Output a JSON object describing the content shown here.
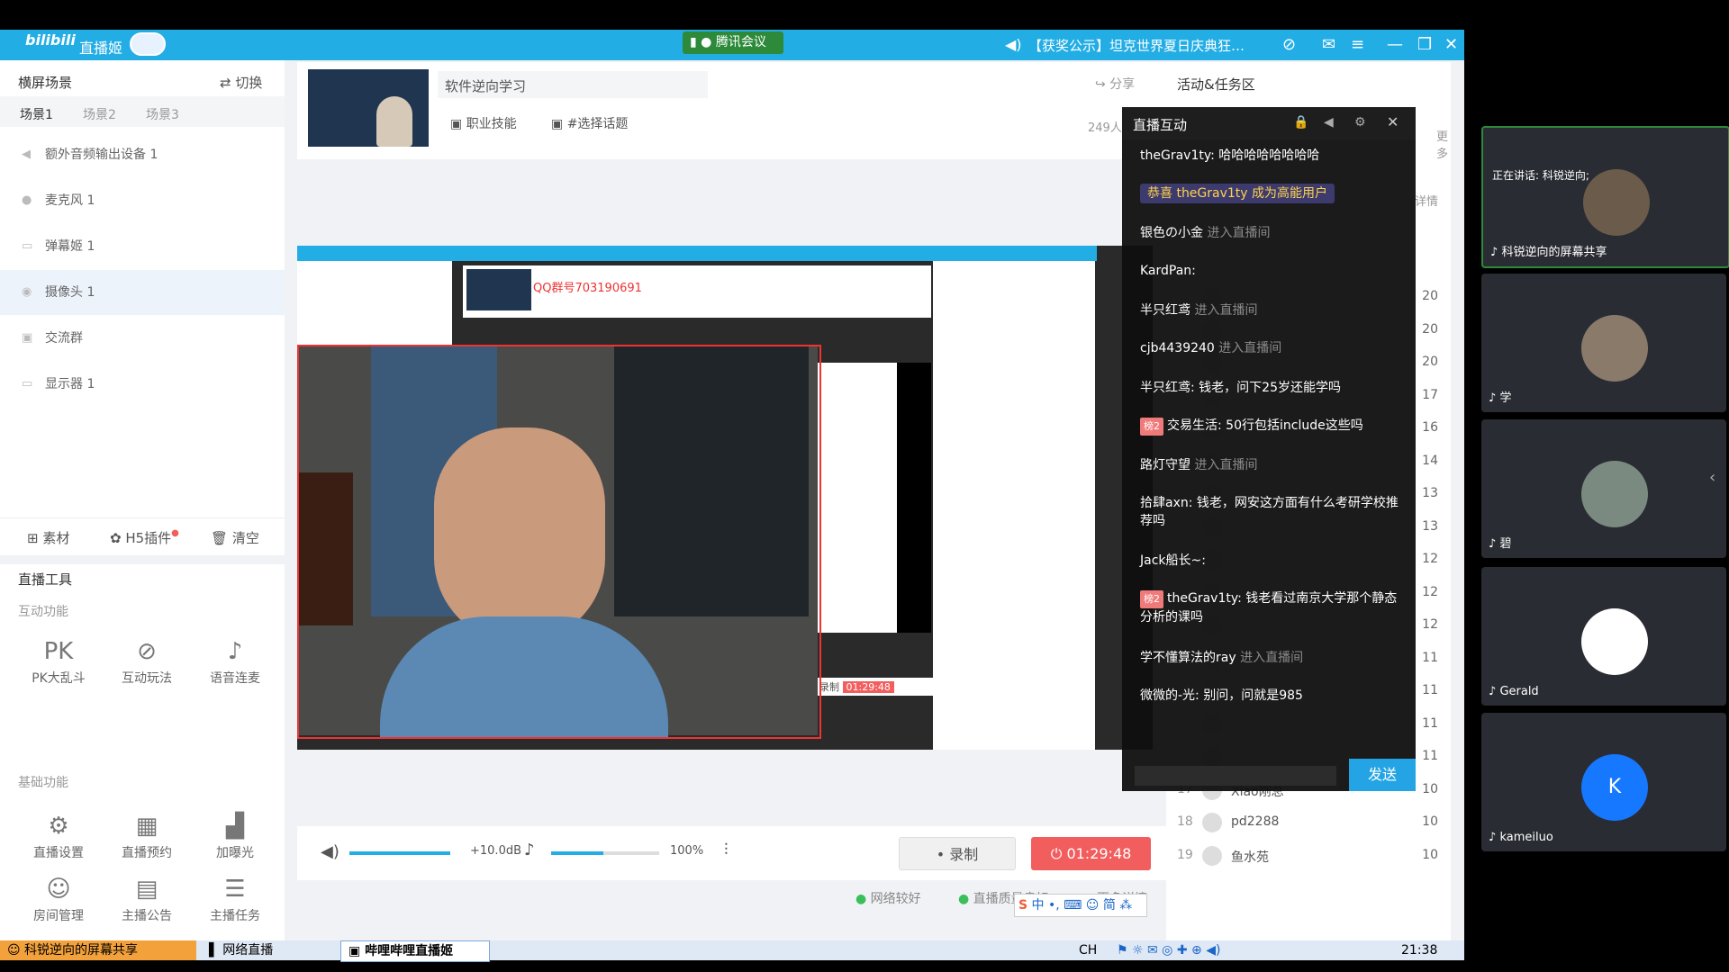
{
  "app": {
    "title": "直播姬",
    "logo": "bilibili"
  },
  "meeting": {
    "label": "腾讯会议",
    "screen_share_label": "科锐逆向的屏幕共享",
    "speaking": "正在讲话: 科锐逆向;"
  },
  "titlebar": {
    "announcement": "【获奖公示】坦克世界夏日庆典狂…"
  },
  "left": {
    "scene_title": "横屏场景",
    "switch_label": "切换",
    "scenes": [
      "场景1",
      "场景2",
      "场景3"
    ],
    "sources": [
      {
        "name": "额外音频输出设备",
        "count": "1",
        "icon": "speaker"
      },
      {
        "name": "麦克风",
        "count": "1",
        "icon": "mic"
      },
      {
        "name": "弹幕姬",
        "count": "1",
        "icon": "chat"
      },
      {
        "name": "摄像头",
        "count": "1",
        "icon": "camera"
      },
      {
        "name": "交流群",
        "count": "",
        "icon": "group"
      },
      {
        "name": "显示器",
        "count": "1",
        "icon": "monitor"
      }
    ],
    "actions": {
      "material": "素材",
      "h5": "H5插件",
      "clear": "清空"
    },
    "tools_title": "直播工具",
    "interactive_title": "互动功能",
    "interactive": [
      "PK大乱斗",
      "互动玩法",
      "语音连麦"
    ],
    "basic_title": "基础功能",
    "basic": [
      "直播设置",
      "直播预约",
      "加曝光",
      "房间管理",
      "主播公告",
      "主播任务"
    ]
  },
  "header": {
    "stream_title": "软件逆向学习",
    "share": "分享",
    "category": "职业技能",
    "topic": "#选择话题",
    "viewers": "249人"
  },
  "controls": {
    "volume_db": "+10.0dB",
    "volume_pct": 1.0,
    "mic_pct": "100%",
    "mic_level": 0.48,
    "record": "录制",
    "timer": "01:29:48"
  },
  "status": {
    "network": "网络较好",
    "quality": "直播质量良好",
    "more": "更多详情"
  },
  "activity": {
    "title": "活动&任务区",
    "more": "更多",
    "detail": "详情"
  },
  "ranks": [
    {
      "rank": "",
      "name": "",
      "score": "20"
    },
    {
      "rank": "",
      "name": "",
      "score": "20"
    },
    {
      "rank": "",
      "name": "",
      "score": "20"
    },
    {
      "rank": "",
      "name": "",
      "score": "17"
    },
    {
      "rank": "",
      "name": "",
      "score": "16"
    },
    {
      "rank": "",
      "name": "",
      "score": "14"
    },
    {
      "rank": "",
      "name": "",
      "score": "13"
    },
    {
      "rank": "",
      "name": "",
      "score": "13"
    },
    {
      "rank": "",
      "name": "",
      "score": "12"
    },
    {
      "rank": "",
      "name": "",
      "score": "12"
    },
    {
      "rank": "",
      "name": "",
      "score": "12"
    },
    {
      "rank": "",
      "name": "",
      "score": "11"
    },
    {
      "rank": "",
      "name": "",
      "score": "11"
    },
    {
      "rank": "",
      "name": "",
      "score": "11"
    },
    {
      "rank": "",
      "name": "",
      "score": "11"
    },
    {
      "rank": "17",
      "name": "Xiao刚总",
      "score": "10"
    },
    {
      "rank": "18",
      "name": "pd2288",
      "score": "10"
    },
    {
      "rank": "19",
      "name": "鱼水苑",
      "score": "10"
    }
  ],
  "chat": {
    "title": "直播互动",
    "send": "发送",
    "messages": [
      {
        "user": "theGrav1ty:",
        "text": " 哈哈哈哈哈哈哈哈",
        "badge": ""
      },
      {
        "user": "恭喜 theGrav1ty 成为高能用户",
        "text": "",
        "badge": "",
        "highlight": true
      },
      {
        "user": "银色の小金",
        "text": " 进入直播间",
        "badge": "",
        "enter": true
      },
      {
        "user": "KardPan:",
        "text": " ",
        "badge": ""
      },
      {
        "user": "半只红鸢",
        "text": " 进入直播间",
        "badge": "",
        "enter": true
      },
      {
        "user": "cjb4439240",
        "text": " 进入直播间",
        "badge": "",
        "enter": true
      },
      {
        "user": "半只红鸢:",
        "text": " 钱老，问下25岁还能学吗",
        "badge": ""
      },
      {
        "user": "交易生活:",
        "text": " 50行包括include这些吗",
        "badge": "榜2"
      },
      {
        "user": "路灯守望",
        "text": " 进入直播间",
        "badge": "",
        "enter": true
      },
      {
        "user": "拾肆axn:",
        "text": " 钱老，网安这方面有什么考研学校推荐吗",
        "badge": ""
      },
      {
        "user": "Jack船长~:",
        "text": " ",
        "badge": ""
      },
      {
        "user": "theGrav1ty:",
        "text": " 钱老看过南京大学那个静态分析的课吗",
        "badge": "榜2"
      },
      {
        "user": "学不懂算法的ray",
        "text": " 进入直播间",
        "badge": "",
        "enter": true
      },
      {
        "user": "微微的-光:",
        "text": " 别问，问就是985",
        "badge": ""
      }
    ]
  },
  "participants": [
    {
      "name": "科锐逆向的屏幕共享",
      "color": "#6b5b4a"
    },
    {
      "name": "学",
      "color": "#8a7a6a"
    },
    {
      "name": "碧",
      "color": "#7a8a80"
    },
    {
      "name": "Gerald",
      "color": "#ffffff"
    },
    {
      "name": "kameiluo",
      "color": "#1677ff",
      "initial": "K"
    }
  ],
  "taskbar": {
    "share": "科锐逆向的屏幕共享",
    "item1": "网络直播",
    "item2": "哔哩哔哩直播姬",
    "lang": "CH",
    "time": "21:38"
  },
  "preview_inner": {
    "qq_banner": "QQ群号703190691",
    "timer": "01:29:48",
    "record": "录制"
  }
}
